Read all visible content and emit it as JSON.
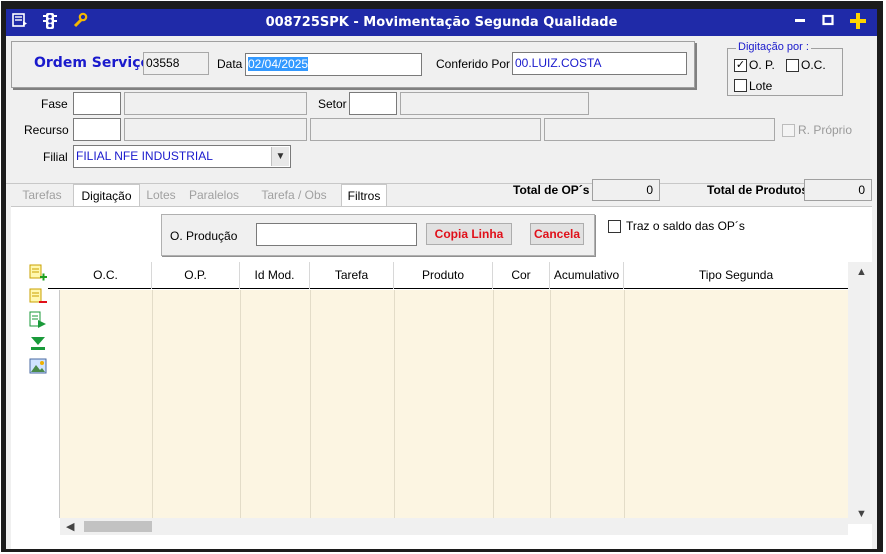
{
  "window": {
    "title": "008725SPK - Movimentação Segunda Qualidade"
  },
  "header": {
    "os_label": "Ordem Serviço",
    "os_value": "03558",
    "data_label": "Data",
    "data_value": "02/04/2025",
    "conferido_label": "Conferido Por",
    "conferido_value": "00.LUIZ.COSTA"
  },
  "digitacao": {
    "title": "Digitação por :",
    "op_label": "O. P.",
    "op_checked": true,
    "oc_label": "O.C.",
    "oc_checked": false,
    "lote_label": "Lote",
    "lote_checked": false
  },
  "fields": {
    "fase_label": "Fase",
    "setor_label": "Setor",
    "recurso_label": "Recurso",
    "r_proprio_label": "R. Próprio",
    "filial_label": "Filial",
    "filial_value": "FILIAL NFE INDUSTRIAL"
  },
  "tabs": [
    {
      "label": "Tarefas"
    },
    {
      "label": "Digitação"
    },
    {
      "label": "Lotes"
    },
    {
      "label": "Paralelos"
    },
    {
      "label": "Tarefa / Obs"
    },
    {
      "label": "Filtros"
    }
  ],
  "totals": {
    "op_label": "Total de OP´s",
    "op_value": "0",
    "produtos_label": "Total de Produtos",
    "produtos_value": "0"
  },
  "producao": {
    "label": "O. Produção",
    "value": "",
    "copia_label": "Copia Linha",
    "cancela_label": "Cancela",
    "traz_saldo_label": "Traz o saldo das OP´s"
  },
  "grid": {
    "columns": [
      "O.C.",
      "O.P.",
      "Id Mod.",
      "Tarefa",
      "Produto",
      "Cor",
      "Acumulativo",
      "Tipo Segunda"
    ]
  },
  "icons": {
    "menu": "menu-icon",
    "traffic": "traffic-light-icon",
    "tools": "wrench-icon",
    "minimize": "minimize-icon",
    "maximize": "maximize-icon",
    "close": "plus-close-icon"
  }
}
